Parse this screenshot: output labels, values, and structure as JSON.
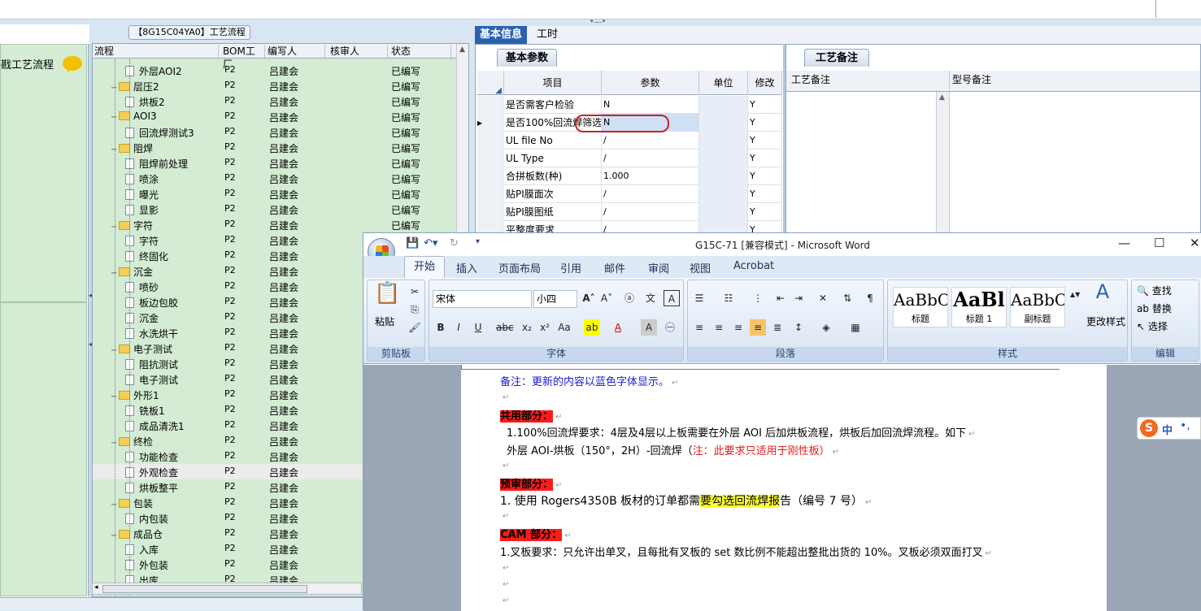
{
  "tree": {
    "title": "【8G15C04YA0】工艺流程",
    "left_label": "戡工艺流程",
    "columns": [
      "流程",
      "BOM工厂",
      "编写人",
      "核审人",
      "状态"
    ],
    "rows": [
      {
        "name": "外层AOI2",
        "type": "doc",
        "bom": "P2",
        "writer": "吕建会",
        "status": "已编写"
      },
      {
        "name": "层压2",
        "type": "folder",
        "bom": "P2",
        "writer": "吕建会",
        "status": "已编写"
      },
      {
        "name": "烘板2",
        "type": "doc",
        "bom": "P2",
        "writer": "吕建会",
        "status": "已编写"
      },
      {
        "name": "AOI3",
        "type": "folder",
        "bom": "P2",
        "writer": "吕建会",
        "status": "已编写"
      },
      {
        "name": "回流焊测试3",
        "type": "doc",
        "bom": "P2",
        "writer": "吕建会",
        "status": "已编写"
      },
      {
        "name": "阻焊",
        "type": "folder",
        "bom": "P2",
        "writer": "吕建会",
        "status": "已编写"
      },
      {
        "name": "阻焊前处理",
        "type": "doc",
        "bom": "P2",
        "writer": "吕建会",
        "status": "已编写"
      },
      {
        "name": "喷涂",
        "type": "doc",
        "bom": "P2",
        "writer": "吕建会",
        "status": "已编写"
      },
      {
        "name": "曝光",
        "type": "doc",
        "bom": "P2",
        "writer": "吕建会",
        "status": "已编写"
      },
      {
        "name": "显影",
        "type": "doc",
        "bom": "P2",
        "writer": "吕建会",
        "status": "已编写"
      },
      {
        "name": "字符",
        "type": "folder",
        "bom": "P2",
        "writer": "吕建会",
        "status": "已编写"
      },
      {
        "name": "字符",
        "type": "doc",
        "bom": "P2",
        "writer": "吕建会",
        "status": ""
      },
      {
        "name": "终固化",
        "type": "doc",
        "bom": "P2",
        "writer": "吕建会",
        "status": ""
      },
      {
        "name": "沉金",
        "type": "folder",
        "bom": "P2",
        "writer": "吕建会",
        "status": ""
      },
      {
        "name": "喷砂",
        "type": "doc",
        "bom": "P2",
        "writer": "吕建会",
        "status": ""
      },
      {
        "name": "板边包胶",
        "type": "doc",
        "bom": "P2",
        "writer": "吕建会",
        "status": ""
      },
      {
        "name": "沉金",
        "type": "doc",
        "bom": "P2",
        "writer": "吕建会",
        "status": ""
      },
      {
        "name": "水洗烘干",
        "type": "doc",
        "bom": "P2",
        "writer": "吕建会",
        "status": ""
      },
      {
        "name": "电子测试",
        "type": "folder",
        "bom": "P2",
        "writer": "吕建会",
        "status": ""
      },
      {
        "name": "阻抗测试",
        "type": "doc",
        "bom": "P2",
        "writer": "吕建会",
        "status": ""
      },
      {
        "name": "电子测试",
        "type": "doc",
        "bom": "P2",
        "writer": "吕建会",
        "status": ""
      },
      {
        "name": "外形1",
        "type": "folder",
        "bom": "P2",
        "writer": "吕建会",
        "status": ""
      },
      {
        "name": "铣板1",
        "type": "doc",
        "bom": "P2",
        "writer": "吕建会",
        "status": ""
      },
      {
        "name": "成品清洗1",
        "type": "doc",
        "bom": "P2",
        "writer": "吕建会",
        "status": ""
      },
      {
        "name": "终检",
        "type": "folder",
        "bom": "P2",
        "writer": "吕建会",
        "status": ""
      },
      {
        "name": "功能检查",
        "type": "doc",
        "bom": "P2",
        "writer": "吕建会",
        "status": ""
      },
      {
        "name": "外观检查",
        "type": "doc",
        "bom": "P2",
        "writer": "吕建会",
        "status": "",
        "selected": true
      },
      {
        "name": "烘板整平",
        "type": "doc",
        "bom": "P2",
        "writer": "吕建会",
        "status": ""
      },
      {
        "name": "包装",
        "type": "folder",
        "bom": "P2",
        "writer": "吕建会",
        "status": ""
      },
      {
        "name": "内包装",
        "type": "doc",
        "bom": "P2",
        "writer": "吕建会",
        "status": ""
      },
      {
        "name": "成品仓",
        "type": "folder",
        "bom": "P2",
        "writer": "吕建会",
        "status": ""
      },
      {
        "name": "入库",
        "type": "doc",
        "bom": "P2",
        "writer": "吕建会",
        "status": ""
      },
      {
        "name": "外包装",
        "type": "doc",
        "bom": "P2",
        "writer": "吕建会",
        "status": ""
      },
      {
        "name": "出库",
        "type": "doc",
        "bom": "P2",
        "writer": "吕建会",
        "status": ""
      }
    ]
  },
  "top_tabs": [
    "基本信息",
    "工时"
  ],
  "base_params": {
    "tab": "基本参数",
    "columns": [
      "项目",
      "参数",
      "单位",
      "修改"
    ],
    "rows": [
      {
        "item": "是否需客户检验",
        "param": "N",
        "unit": "",
        "mod": "Y"
      },
      {
        "item": "是否100%回流焊筛选",
        "param": "N",
        "unit": "",
        "mod": "Y",
        "current": true
      },
      {
        "item": "UL file No",
        "param": "/",
        "unit": "",
        "mod": "Y"
      },
      {
        "item": "UL Type",
        "param": "/",
        "unit": "",
        "mod": "Y"
      },
      {
        "item": "合拼板数(种)",
        "param": "1.000",
        "unit": "",
        "mod": "Y"
      },
      {
        "item": "贴PI膜面次",
        "param": "/",
        "unit": "",
        "mod": "Y"
      },
      {
        "item": "贴PI膜图纸",
        "param": "/",
        "unit": "",
        "mod": "Y"
      },
      {
        "item": "平整度要求",
        "param": "/",
        "unit": "",
        "mod": "Y"
      }
    ]
  },
  "notes": {
    "tab": "工艺备注",
    "col1": "工艺备注",
    "col2": "型号备注"
  },
  "word": {
    "title": "G15C-71 [兼容模式] - Microsoft Word",
    "tabs": [
      "开始",
      "插入",
      "页面布局",
      "引用",
      "邮件",
      "审阅",
      "视图",
      "Acrobat"
    ],
    "clipboard": {
      "paste": "粘贴",
      "label": "剪贴板"
    },
    "font": {
      "name": "宋体",
      "size": "小四",
      "label": "字体"
    },
    "paragraph_label": "段落",
    "styles": {
      "items": [
        {
          "sample": "AaBbC",
          "name": "标题"
        },
        {
          "sample": "AaBl",
          "name": "标题 1"
        },
        {
          "sample": "AaBbC",
          "name": "副标题"
        }
      ],
      "change": "更改样式",
      "label": "样式"
    },
    "editing": {
      "find": "查找",
      "replace": "替换",
      "select": "选择",
      "label": "编辑"
    },
    "doc": {
      "note": "备注：更新的内容以蓝色字体显示。",
      "shared_head": "共用部分：",
      "shared_1": "1.100%回流焊要求：4层及4层以上板需要在外层 AOI 后加烘板流程，烘板后加回流焊流程。如下",
      "shared_2a": "外层 AOI-烘板（150°，2H）-回流焊（",
      "shared_2b": "注：此要求只适用于刚性板",
      "shared_2c": "）",
      "pre_head": "预审部分：",
      "pre_1a": "1. 使用 Rogers4350B 板材的订单都需",
      "pre_1b": "要勾选回流焊报",
      "pre_1c": "告（编号 7 号）",
      "cam_head": "CAM 部分：",
      "cam_1": "1.叉板要求：只允许出单叉，且每批有叉板的 set 数比例不能超出整批出货的 10%。叉板必须双面打叉"
    }
  },
  "ime": {
    "lang": "中",
    "punct": "•,"
  }
}
